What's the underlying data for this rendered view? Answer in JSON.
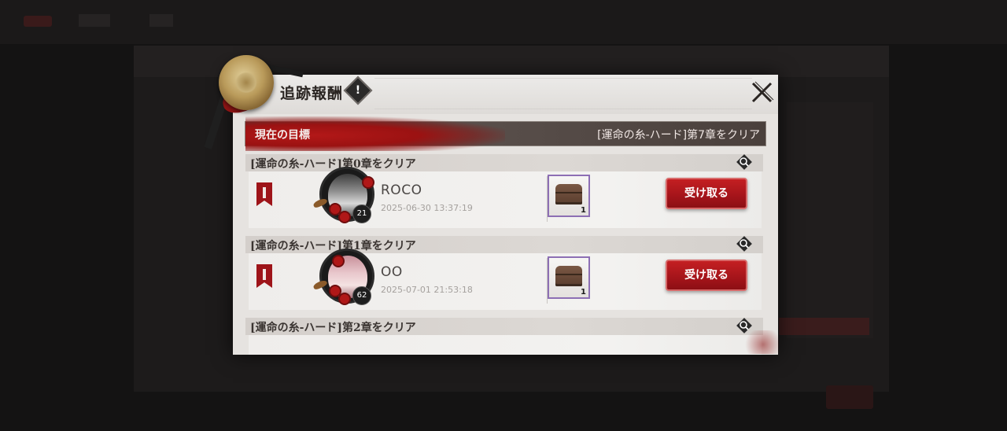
{
  "modal": {
    "title": "追跡報酬",
    "alert_symbol": "!",
    "current_target_label": "現在の目標",
    "current_target_value": "[運命の糸-ハード]第7章をクリア"
  },
  "rows": [
    {
      "header": "[運命の糸-ハード]第0章をクリア",
      "player_name": "ROCO",
      "timestamp": "2025-06-30  13:37:19",
      "level": "21",
      "reward_count": "1",
      "claim_label": "受け取る"
    },
    {
      "header": "[運命の糸-ハード]第1章をクリア",
      "player_name": "OO",
      "timestamp": "2025-07-01  21:53:18",
      "level": "62",
      "reward_count": "1",
      "claim_label": "受け取る"
    },
    {
      "header": "[運命の糸-ハード]第2章をクリア"
    }
  ],
  "colors": {
    "accent_red": "#a4141a",
    "reward_border": "#8d6fb4"
  },
  "icons": [
    "wax-seal-icon",
    "alert-icon",
    "close-icon",
    "search-icon",
    "banner-icon",
    "treasure-chest-icon"
  ]
}
